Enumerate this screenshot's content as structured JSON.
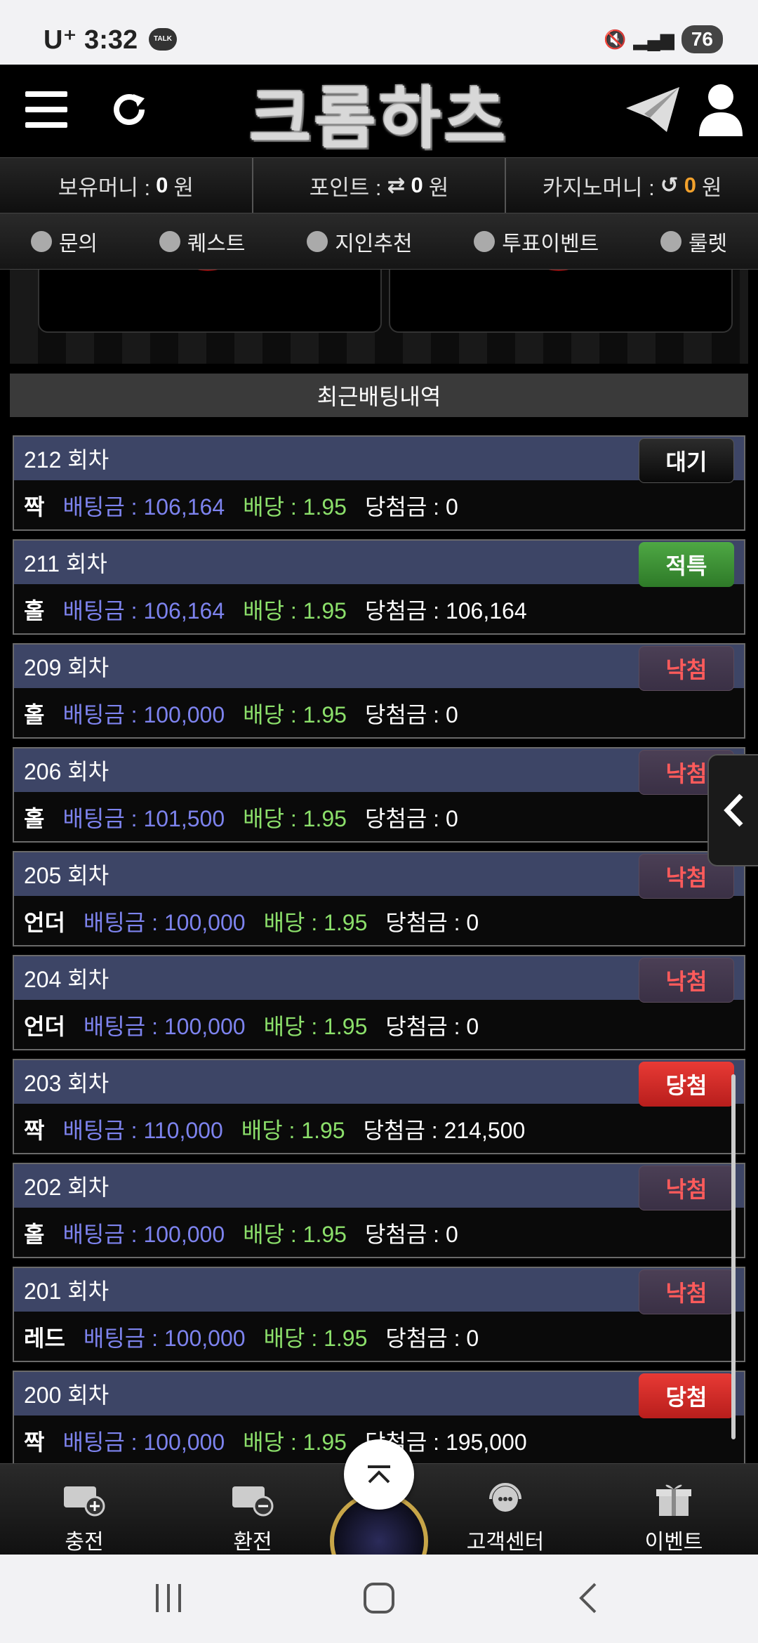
{
  "status_bar": {
    "carrier": "U⁺ 3:32",
    "talk": "TALK",
    "battery": "76"
  },
  "header": {
    "logo": "크롬하츠"
  },
  "money": {
    "holding_label": "보유머니 :",
    "holding_value": "0",
    "holding_unit": "원",
    "point_label": "포인트 :",
    "point_value": "0",
    "point_unit": "원",
    "casino_label": "카지노머니 :",
    "casino_value": "0",
    "casino_unit": "원"
  },
  "menu": [
    {
      "label": "문의"
    },
    {
      "label": "퀘스트"
    },
    {
      "label": "지인추천"
    },
    {
      "label": "투표이벤트"
    },
    {
      "label": "룰렛"
    }
  ],
  "section_title": "최근배팅내역",
  "bets": [
    {
      "round": "212 회차",
      "status": "대기",
      "type": "wait",
      "pick": "짝",
      "amount": "배팅금 : 106,164",
      "odds": "배당 : 1.95",
      "win": "당첨금 : 0"
    },
    {
      "round": "211 회차",
      "status": "적특",
      "type": "refund",
      "pick": "홀",
      "amount": "배팅금 : 106,164",
      "odds": "배당 : 1.95",
      "win": "당첨금 : 106,164"
    },
    {
      "round": "209 회차",
      "status": "낙첨",
      "type": "lose",
      "pick": "홀",
      "amount": "배팅금 : 100,000",
      "odds": "배당 : 1.95",
      "win": "당첨금 : 0"
    },
    {
      "round": "206 회차",
      "status": "낙첨",
      "type": "lose",
      "pick": "홀",
      "amount": "배팅금 : 101,500",
      "odds": "배당 : 1.95",
      "win": "당첨금 : 0"
    },
    {
      "round": "205 회차",
      "status": "낙첨",
      "type": "lose",
      "pick": "언더",
      "amount": "배팅금 : 100,000",
      "odds": "배당 : 1.95",
      "win": "당첨금 : 0"
    },
    {
      "round": "204 회차",
      "status": "낙첨",
      "type": "lose",
      "pick": "언더",
      "amount": "배팅금 : 100,000",
      "odds": "배당 : 1.95",
      "win": "당첨금 : 0"
    },
    {
      "round": "203 회차",
      "status": "당첨",
      "type": "win",
      "pick": "짝",
      "amount": "배팅금 : 110,000",
      "odds": "배당 : 1.95",
      "win": "당첨금 : 214,500"
    },
    {
      "round": "202 회차",
      "status": "낙첨",
      "type": "lose",
      "pick": "홀",
      "amount": "배팅금 : 100,000",
      "odds": "배당 : 1.95",
      "win": "당첨금 : 0"
    },
    {
      "round": "201 회차",
      "status": "낙첨",
      "type": "lose",
      "pick": "레드",
      "amount": "배팅금 : 100,000",
      "odds": "배당 : 1.95",
      "win": "당첨금 : 0"
    },
    {
      "round": "200 회차",
      "status": "당첨",
      "type": "win",
      "pick": "짝",
      "amount": "배팅금 : 100,000",
      "odds": "배당 : 1.95",
      "win": "당첨금 : 195,000"
    }
  ],
  "bottom_nav": [
    {
      "label": "충전"
    },
    {
      "label": "환전"
    },
    {
      "label": "고객센터"
    },
    {
      "label": "이벤트"
    }
  ],
  "colors": {
    "header_row": "#3d4566",
    "amount": "#7d83ee",
    "odds": "#8ce06b",
    "win_badge": "#e83a35",
    "refund_badge": "#4ea844",
    "lose_text": "#ff5b5b"
  }
}
